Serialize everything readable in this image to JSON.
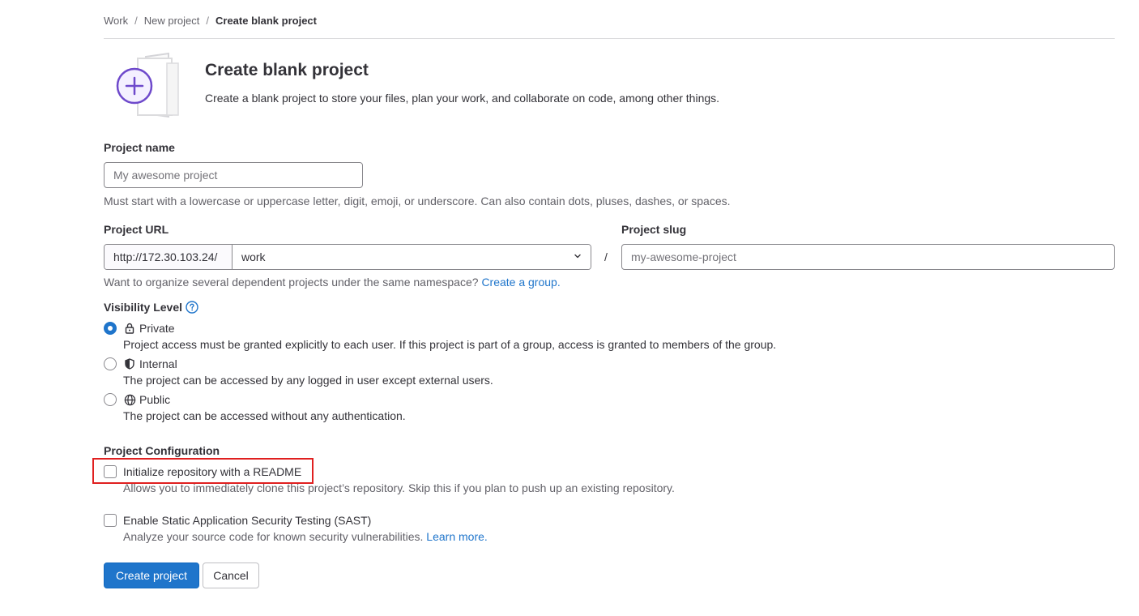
{
  "breadcrumb": {
    "items": [
      "Work",
      "New project"
    ],
    "current": "Create blank project",
    "separator": "/"
  },
  "header": {
    "title": "Create blank project",
    "description": "Create a blank project to store your files, plan your work, and collaborate on code, among other things."
  },
  "project_name": {
    "label": "Project name",
    "placeholder": "My awesome project",
    "value": "",
    "help": "Must start with a lowercase or uppercase letter, digit, emoji, or underscore. Can also contain dots, pluses, dashes, or spaces."
  },
  "project_url": {
    "label": "Project URL",
    "prefix": "http://172.30.103.24/",
    "namespace": "work",
    "separator": "/",
    "help_text": "Want to organize several dependent projects under the same namespace?",
    "help_link": "Create a group."
  },
  "project_slug": {
    "label": "Project slug",
    "placeholder": "my-awesome-project",
    "value": ""
  },
  "visibility": {
    "label": "Visibility Level",
    "options": [
      {
        "label": "Private",
        "icon": "lock-icon",
        "checked": true,
        "desc": "Project access must be granted explicitly to each user. If this project is part of a group, access is granted to members of the group."
      },
      {
        "label": "Internal",
        "icon": "shield-icon",
        "checked": false,
        "desc": "The project can be accessed by any logged in user except external users."
      },
      {
        "label": "Public",
        "icon": "globe-icon",
        "checked": false,
        "desc": "The project can be accessed without any authentication."
      }
    ]
  },
  "configuration": {
    "label": "Project Configuration",
    "readme": {
      "label": "Initialize repository with a README",
      "checked": false,
      "desc": "Allows you to immediately clone this project’s repository. Skip this if you plan to push up an existing repository."
    },
    "sast": {
      "label": "Enable Static Application Security Testing (SAST)",
      "checked": false,
      "desc": "Analyze your source code for known security vulnerabilities.",
      "link": "Learn more."
    }
  },
  "actions": {
    "create": "Create project",
    "cancel": "Cancel"
  },
  "colors": {
    "accent": "#1f75cb",
    "highlight": "#e02020",
    "illustration": "#6e49cb"
  }
}
